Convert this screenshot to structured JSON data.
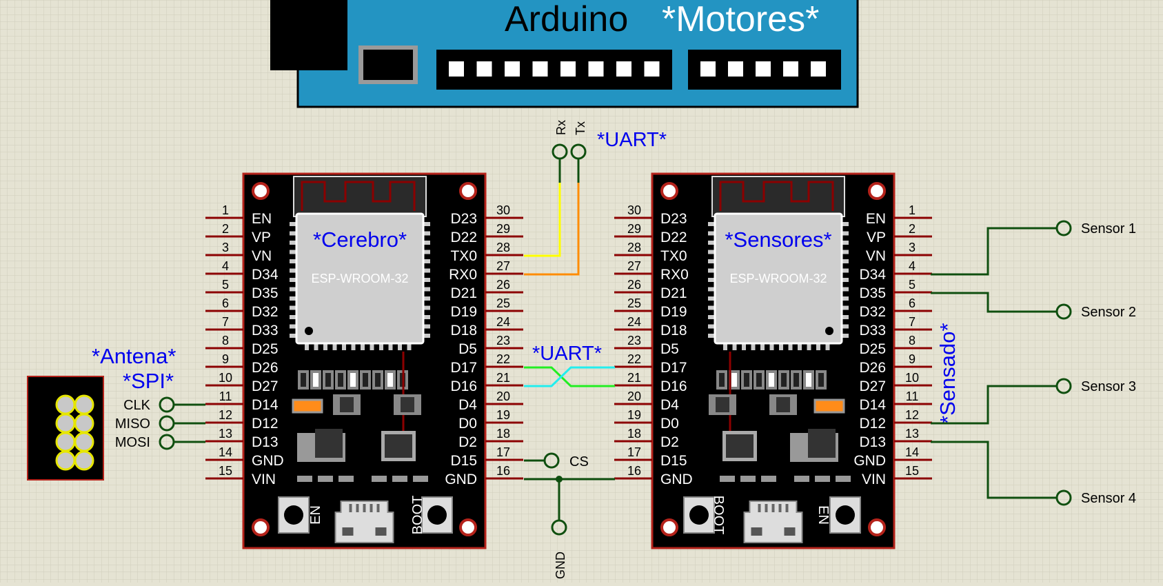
{
  "arduino": {
    "name": "Arduino",
    "label": "*Motores*"
  },
  "uart_top": {
    "label": "*UART*",
    "rx": "Rx",
    "tx": "Tx"
  },
  "uart_mid": {
    "label": "*UART*"
  },
  "board_left": {
    "label": "*Cerebro*",
    "module": "ESP-WROOM-32",
    "left_pins": [
      {
        "num": "1",
        "name": "EN"
      },
      {
        "num": "2",
        "name": "VP"
      },
      {
        "num": "3",
        "name": "VN"
      },
      {
        "num": "4",
        "name": "D34"
      },
      {
        "num": "5",
        "name": "D35"
      },
      {
        "num": "6",
        "name": "D32"
      },
      {
        "num": "7",
        "name": "D33"
      },
      {
        "num": "8",
        "name": "D25"
      },
      {
        "num": "9",
        "name": "D26"
      },
      {
        "num": "10",
        "name": "D27"
      },
      {
        "num": "11",
        "name": "D14"
      },
      {
        "num": "12",
        "name": "D12"
      },
      {
        "num": "13",
        "name": "D13"
      },
      {
        "num": "14",
        "name": "GND"
      },
      {
        "num": "15",
        "name": "VIN"
      }
    ],
    "right_pins": [
      {
        "num": "30",
        "name": "D23"
      },
      {
        "num": "29",
        "name": "D22"
      },
      {
        "num": "28",
        "name": "TX0"
      },
      {
        "num": "27",
        "name": "RX0"
      },
      {
        "num": "26",
        "name": "D21"
      },
      {
        "num": "25",
        "name": "D19"
      },
      {
        "num": "24",
        "name": "D18"
      },
      {
        "num": "23",
        "name": "D5"
      },
      {
        "num": "22",
        "name": "D17"
      },
      {
        "num": "21",
        "name": "D16"
      },
      {
        "num": "20",
        "name": "D4"
      },
      {
        "num": "19",
        "name": "D0"
      },
      {
        "num": "18",
        "name": "D2"
      },
      {
        "num": "17",
        "name": "D15"
      },
      {
        "num": "16",
        "name": "GND"
      }
    ],
    "btn_left": "EN",
    "btn_right": "BOOT"
  },
  "board_right": {
    "label": "*Sensores*",
    "module": "ESP-WROOM-32",
    "left_pins": [
      {
        "num": "30",
        "name": "D23"
      },
      {
        "num": "29",
        "name": "D22"
      },
      {
        "num": "28",
        "name": "TX0"
      },
      {
        "num": "27",
        "name": "RX0"
      },
      {
        "num": "26",
        "name": "D21"
      },
      {
        "num": "25",
        "name": "D19"
      },
      {
        "num": "24",
        "name": "D18"
      },
      {
        "num": "23",
        "name": "D5"
      },
      {
        "num": "22",
        "name": "D17"
      },
      {
        "num": "21",
        "name": "D16"
      },
      {
        "num": "20",
        "name": "D4"
      },
      {
        "num": "19",
        "name": "D0"
      },
      {
        "num": "18",
        "name": "D2"
      },
      {
        "num": "17",
        "name": "D15"
      },
      {
        "num": "16",
        "name": "GND"
      }
    ],
    "right_pins": [
      {
        "num": "1",
        "name": "EN"
      },
      {
        "num": "2",
        "name": "VP"
      },
      {
        "num": "3",
        "name": "VN"
      },
      {
        "num": "4",
        "name": "D34"
      },
      {
        "num": "5",
        "name": "D35"
      },
      {
        "num": "6",
        "name": "D32"
      },
      {
        "num": "7",
        "name": "D33"
      },
      {
        "num": "8",
        "name": "D25"
      },
      {
        "num": "9",
        "name": "D26"
      },
      {
        "num": "10",
        "name": "D27"
      },
      {
        "num": "11",
        "name": "D14"
      },
      {
        "num": "12",
        "name": "D12"
      },
      {
        "num": "13",
        "name": "D13"
      },
      {
        "num": "14",
        "name": "GND"
      },
      {
        "num": "15",
        "name": "VIN"
      }
    ],
    "btn_left": "BOOT",
    "btn_right": "EN"
  },
  "antenna": {
    "label": "*Antena*",
    "bus": "*SPI*",
    "signals": [
      "CLK",
      "MISO",
      "MOSI"
    ]
  },
  "cs_label": "CS",
  "gnd_label": "GND",
  "sensado_label": "*Sensado*",
  "sensors": [
    "Sensor 1",
    "Sensor 2",
    "Sensor 3",
    "Sensor 4"
  ],
  "colors": {
    "background": "#e5e3d3",
    "grid": "#cfccbb",
    "board": "#000000",
    "board_border": "#b5231b",
    "pin": "#8b0000",
    "wire": "#0f4f0f",
    "annotation": "#0000ee",
    "arduino": "#2394c2",
    "module": "#cfcfcf",
    "wire_tx": "#ffff00",
    "wire_rx": "#ff8c00",
    "wire_d17": "#22ee22",
    "wire_d16": "#22eeee",
    "orange_part": "#ff8c1a"
  }
}
